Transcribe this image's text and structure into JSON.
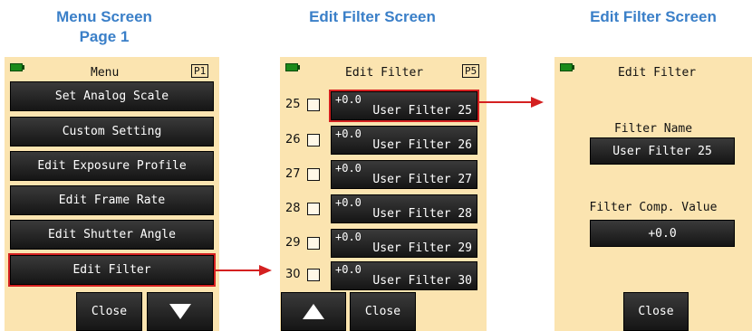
{
  "headings": {
    "menu_line1": "Menu Screen",
    "menu_line2": "Page 1",
    "edit_filter_1": "Edit Filter Screen",
    "edit_filter_2": "Edit Filter Screen"
  },
  "menu_screen": {
    "title": "Menu",
    "page_indicator": "P1",
    "items": [
      {
        "label": "Set Analog Scale"
      },
      {
        "label": "Custom Setting"
      },
      {
        "label": "Edit Exposure Profile"
      },
      {
        "label": "Edit Frame Rate"
      },
      {
        "label": "Edit Shutter Angle"
      },
      {
        "label": "Edit Filter"
      }
    ],
    "selected_item": "Edit Filter",
    "close_label": "Close",
    "down_icon": "triangle-down-icon"
  },
  "filter_list_screen": {
    "title": "Edit Filter",
    "page_indicator": "P5",
    "rows": [
      {
        "number": "25",
        "value": "+0.0",
        "name": "User Filter 25"
      },
      {
        "number": "26",
        "value": "+0.0",
        "name": "User Filter 26"
      },
      {
        "number": "27",
        "value": "+0.0",
        "name": "User Filter 27"
      },
      {
        "number": "28",
        "value": "+0.0",
        "name": "User Filter 28"
      },
      {
        "number": "29",
        "value": "+0.0",
        "name": "User Filter 29"
      },
      {
        "number": "30",
        "value": "+0.0",
        "name": "User Filter 30"
      }
    ],
    "selected_row": "User Filter 25",
    "close_label": "Close",
    "up_icon": "triangle-up-icon"
  },
  "filter_detail_screen": {
    "title": "Edit Filter",
    "filter_name_label": "Filter Name",
    "filter_name_value": "User Filter 25",
    "comp_value_label": "Filter Comp. Value",
    "comp_value": "+0.0",
    "close_label": "Close"
  },
  "colors": {
    "heading": "#3a7fc8",
    "screen_bg": "#fbe4b0",
    "button_bg": "#1e1e1e",
    "highlight": "#d42020",
    "battery": "#1a8a1a"
  }
}
